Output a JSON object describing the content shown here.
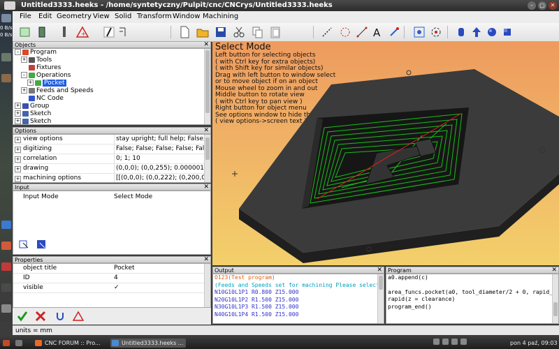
{
  "window": {
    "title": "Untitled3333.heeks - /home/syntetyczny/Pulpit/cnc/CNCrys/Untitled3333.heeks",
    "controls": [
      "–",
      "▢",
      "✕"
    ]
  },
  "desktop": {
    "labels": [
      "0 B/s",
      "0 B/s"
    ]
  },
  "menu": [
    "File",
    "Edit",
    "Geometry",
    "View",
    "Solid",
    "Transform",
    "Window",
    "Machining"
  ],
  "toolbar": {
    "icons": [
      "select-rect-icon",
      "phone-icon",
      "drill-icon",
      "warning-triangle-icon",
      "pen-icon",
      "crop-icon",
      "new-file-icon",
      "open-folder-icon",
      "save-icon",
      "cut-icon",
      "copy-icon",
      "paste-icon",
      "line-icon",
      "circle-icon",
      "dim-icon",
      "text-icon",
      "point-icon",
      "view-fit-icon",
      "rotate-icon",
      "cylinder-icon",
      "up-arrow-icon",
      "cube-icon",
      "cone-icon"
    ]
  },
  "objects": {
    "header": "Objects",
    "tree": [
      {
        "label": "Program",
        "depth": 0,
        "exp": "–",
        "color": "#d94a2a"
      },
      {
        "label": "Tools",
        "depth": 1,
        "exp": "+",
        "color": "#555555"
      },
      {
        "label": "Fixtures",
        "depth": 1,
        "exp": "",
        "color": "#c04040"
      },
      {
        "label": "Operations",
        "depth": 1,
        "exp": "–",
        "color": "#44aa44"
      },
      {
        "label": "Pocket",
        "depth": 2,
        "exp": "+",
        "color": "#44aa44",
        "selected": true
      },
      {
        "label": "Feeds and Speeds",
        "depth": 1,
        "exp": "+",
        "color": "#777777"
      },
      {
        "label": "NC Code",
        "depth": 1,
        "exp": "",
        "color": "#3355cc"
      },
      {
        "label": "Group",
        "depth": 0,
        "exp": "+",
        "color": "#3b4fb0"
      },
      {
        "label": "Sketch",
        "depth": 0,
        "exp": "+",
        "color": "#4466aa"
      },
      {
        "label": "Sketch",
        "depth": 0,
        "exp": "+",
        "color": "#4466aa"
      }
    ]
  },
  "options": {
    "header": "Options",
    "rows": [
      {
        "name": "view options",
        "value": "stay upright; full help; False; Fa"
      },
      {
        "name": "digitizing",
        "value": "False; False; False; False; False;"
      },
      {
        "name": "correlation",
        "value": "0; 1; 10"
      },
      {
        "name": "drawing",
        "value": "(0,0,0); (0,0,255); 0.000001; 0; F"
      },
      {
        "name": "machining options",
        "value": "[[(0,0,0); (0,0,222); (0,200,0); (2"
      }
    ]
  },
  "input": {
    "header": "Input",
    "label": "Input Mode",
    "value": "Select Mode"
  },
  "properties": {
    "header": "Properties",
    "rows": [
      {
        "name": "object title",
        "value": "Pocket"
      },
      {
        "name": "ID",
        "value": "4"
      },
      {
        "name": "visible",
        "value": "✓"
      }
    ]
  },
  "help": {
    "title": "Select Mode",
    "lines": [
      "Left button for selecting objects",
      "( with Ctrl key for extra objects)",
      "( with Shift key for similar objects)",
      "Drag with left button to window select",
      "or to move object if on an object",
      "Mouse wheel to zoom in and out",
      "Middle button to rotate view",
      "( with Ctrl key to pan view )",
      "Right button for object menu",
      "See options window to hide this help",
      "( view options->screen text )"
    ]
  },
  "output": {
    "header": "Output",
    "lines": [
      {
        "text": "O123(Test program)",
        "color": "#e06010"
      },
      {
        "text": "(Feeds and Speeds set for machining Please select a mate",
        "color": "#00a0c0"
      },
      {
        "text": "N10G10L1P1 R0.800 Z15.000",
        "color": "#3030cc"
      },
      {
        "text": "N20G10L1P2 R1.500 Z15.000",
        "color": "#3030cc"
      },
      {
        "text": "N30G10L1P3 R1.500 Z15.000",
        "color": "#3030cc"
      },
      {
        "text": "N40G10L1P4 R1.500 Z15.000",
        "color": "#3030cc"
      }
    ]
  },
  "program": {
    "header": "Program",
    "lines": [
      "a0.append(c)",
      "",
      "area_funcs.pocket(a0, tool_diameter/2 + 0, rapid_down_to",
      "rapid(z = clearance)",
      "program_end()"
    ]
  },
  "status": "units = mm",
  "taskbar": {
    "items": [
      "CNC FORUM :: Pro...",
      "Untitled3333.heeks ..."
    ],
    "clock": "pon 4 paź, 09:03"
  }
}
